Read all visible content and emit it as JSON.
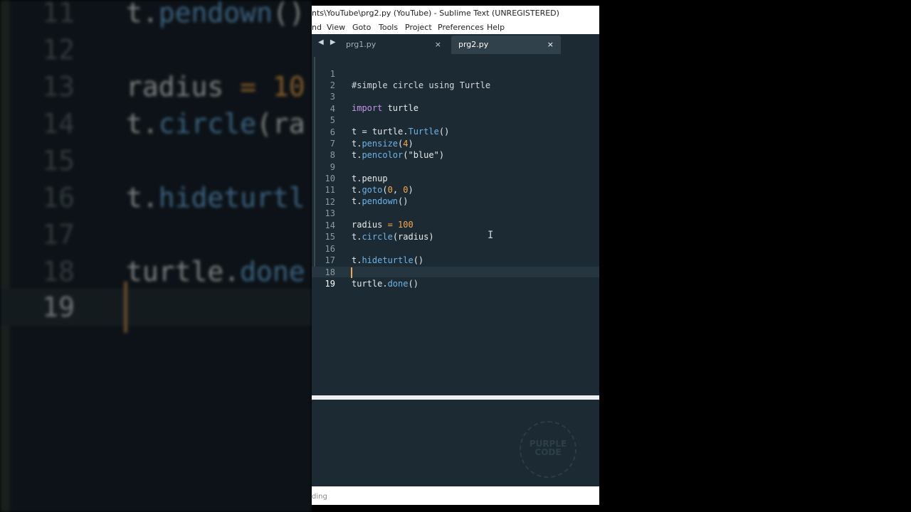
{
  "window": {
    "title": "nts\\YouTube\\prg2.py (YouTube) - Sublime Text (UNREGISTERED)"
  },
  "menu": [
    "nd",
    "View",
    "Goto",
    "Tools",
    "Project",
    "Preferences",
    "Help"
  ],
  "tabs": [
    {
      "label": "prg1.py",
      "close": "×",
      "active": false
    },
    {
      "label": "prg2.py",
      "close": "×",
      "active": true
    }
  ],
  "tab_nav": "◀ ▶",
  "code_lines": [
    {
      "n": "1",
      "text": "#simple circle using Turtle"
    },
    {
      "n": "2",
      "text": ""
    },
    {
      "n": "3",
      "text": "import turtle"
    },
    {
      "n": "4",
      "text": ""
    },
    {
      "n": "5",
      "text": "t = turtle.Turtle()"
    },
    {
      "n": "6",
      "text": "t.pensize(4)"
    },
    {
      "n": "7",
      "text": "t.pencolor(\"blue\")"
    },
    {
      "n": "8",
      "text": ""
    },
    {
      "n": "9",
      "text": "t.penup"
    },
    {
      "n": "10",
      "text": "t.goto(0, 0)"
    },
    {
      "n": "11",
      "text": "t.pendown()"
    },
    {
      "n": "12",
      "text": ""
    },
    {
      "n": "13",
      "text": "radius = 100"
    },
    {
      "n": "14",
      "text": "t.circle(radius)"
    },
    {
      "n": "15",
      "text": ""
    },
    {
      "n": "16",
      "text": "t.hideturtle()"
    },
    {
      "n": "17",
      "text": ""
    },
    {
      "n": "18",
      "text": "turtle.done()"
    },
    {
      "n": "19",
      "text": ""
    }
  ],
  "current_line": "19",
  "background_zoom": [
    {
      "n": "11",
      "text": "t.pendown()"
    },
    {
      "n": "12",
      "text": ""
    },
    {
      "n": "13",
      "text": "radius = 10"
    },
    {
      "n": "14",
      "text": "t.circle(ra"
    },
    {
      "n": "15",
      "text": ""
    },
    {
      "n": "16",
      "text": "t.hideturtl"
    },
    {
      "n": "17",
      "text": ""
    },
    {
      "n": "18",
      "text": "turtle.done"
    },
    {
      "n": "19",
      "text": ""
    }
  ],
  "watermark": {
    "line1": "PURPLE",
    "line2": "CODE"
  },
  "status": {
    "text": "ding"
  },
  "colors": {
    "editor_bg": "#1c2b33",
    "keyword": "#c792ea",
    "function": "#6db3e8",
    "number": "#f7a94a",
    "caret": "#f0a84e"
  }
}
